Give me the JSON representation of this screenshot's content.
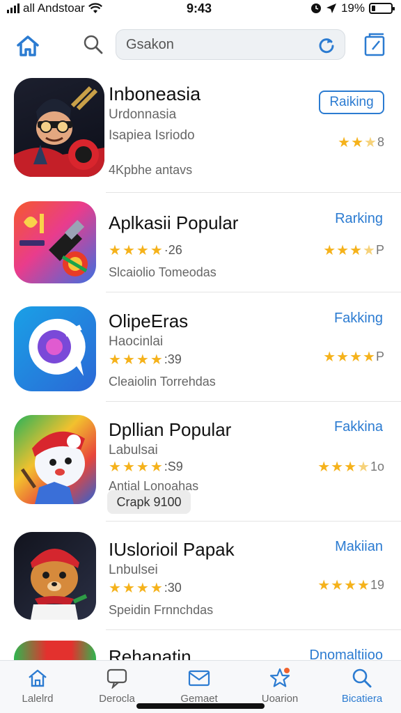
{
  "status": {
    "carrier": "all Andstoar",
    "time": "9:43",
    "battery": "19%",
    "battery_level": 0.19
  },
  "search": {
    "value": "Gsakon"
  },
  "apps": [
    {
      "name": "Inboneasia",
      "subtitle": "Urdonnasia",
      "line3": "Isapiea Isriodo",
      "category": "4Kpbhe antavs",
      "action": "Raiking",
      "right_rating_text": "8",
      "icon": "warrior-game-icon"
    },
    {
      "name": "Aplkasii Popular",
      "rating_text": "·26",
      "category": "Slcaiolio Tomeodas",
      "action": "Rarking",
      "right_rating_text": "P",
      "icon": "rocket-game-icon"
    },
    {
      "name": "OlipeEras",
      "subtitle": "Haocinlai",
      "rating_text": ":39",
      "category": "Cleaiolin Torrehdas",
      "action": "Fakking",
      "right_rating_text": "P",
      "icon": "chat-bubble-icon"
    },
    {
      "name": "Dpllian Popular",
      "subtitle": "Labulsai",
      "rating_text": ":S9",
      "category": "Antial Lonoahas",
      "chip": "Crapk 9100",
      "action": "Fakkina",
      "right_rating_text": "1o",
      "icon": "character-game-icon"
    },
    {
      "name": "IUslorioil Papak",
      "subtitle": "Lnbulsei",
      "rating_text": ":30",
      "category": "Speidin Frnnchdas",
      "action": "Makiian",
      "right_rating_text": "19",
      "icon": "bear-game-icon"
    },
    {
      "name": "Rehanatin",
      "action": "Dnomaltiioo",
      "icon": "red-game-icon"
    }
  ],
  "tabs": [
    {
      "label": "Lalelrd",
      "icon": "home-icon"
    },
    {
      "label": "Derocla",
      "icon": "chat-icon"
    },
    {
      "label": "Gemaet",
      "icon": "mail-icon"
    },
    {
      "label": "Uoarion",
      "icon": "star-icon"
    },
    {
      "label": "Bicatiera",
      "icon": "search-icon"
    }
  ],
  "colors": {
    "accent": "#2b7bd1",
    "star": "#f5b21b",
    "divider": "#e3e3e3"
  }
}
